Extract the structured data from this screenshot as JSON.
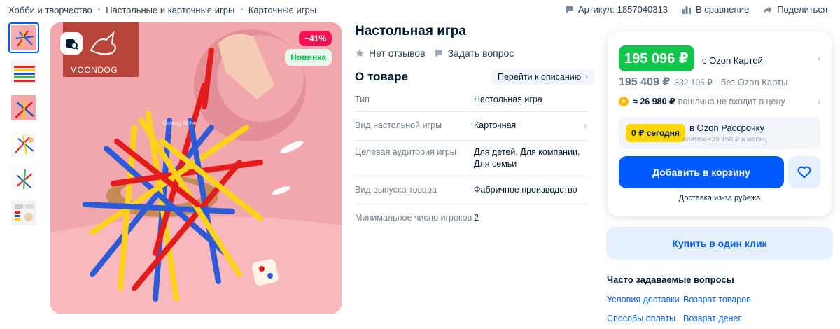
{
  "breadcrumbs": [
    "Хобби и творчество",
    "Настольные и карточные игры",
    "Карточные игры"
  ],
  "top_actions": {
    "article": "Артикул: 1857040313",
    "compare": "В сравнение",
    "share": "Поделиться"
  },
  "gallery": {
    "badge_discount": "−41%",
    "badge_new": "Новинка",
    "brand_logo": "MOONDOG",
    "watermark": "Guang Mihe",
    "thumbnail_count": 6
  },
  "product": {
    "title": "Настольная игра",
    "reviews": "Нет отзывов",
    "ask": "Задать вопрос"
  },
  "about": {
    "title": "О товаре",
    "goto_label": "Перейти к описанию",
    "properties": [
      {
        "key": "Тип",
        "value": "Настольная игра"
      },
      {
        "key": "Вид настольной игры",
        "value": "Карточная"
      },
      {
        "key": "Целевая аудитория игры",
        "value": "Для детей, Для компании, Для семьи"
      },
      {
        "key": "Вид выпуска товара",
        "value": "Фабричное производство"
      },
      {
        "key": "Минимальное число игроков",
        "value": "2"
      }
    ]
  },
  "buy_card": {
    "price_ozon_card": "195 096 ₽",
    "price_ozon_card_label": "с Ozon Картой",
    "price_regular": "195 409 ₽",
    "price_old": "332 195 ₽",
    "price_regular_label": "без Ozon Карты",
    "duty_icon": "+",
    "duty_value": "≈ 26 980 ₽",
    "duty_label": "пошлина не входит в цену",
    "installment_badge": "0 ₽ сегодня",
    "installment_title": "в Ozon Рассрочку",
    "installment_sub": "платеж ≈39 150 ₽ в месяц",
    "add_to_cart": "Добавить в корзину",
    "delivery_note": "Доставка из-за рубежа"
  },
  "buy_one_click": "Купить в один клик",
  "faq": {
    "title": "Часто задаваемые вопросы",
    "links": [
      "Условия доставки",
      "Возврат товаров",
      "Способы оплаты",
      "Возврат денег"
    ]
  },
  "colors": {
    "accent_blue": "#005bff",
    "price_green": "#10c44c",
    "discount_red": "#f91155",
    "installment_yellow": "#ffd600"
  }
}
